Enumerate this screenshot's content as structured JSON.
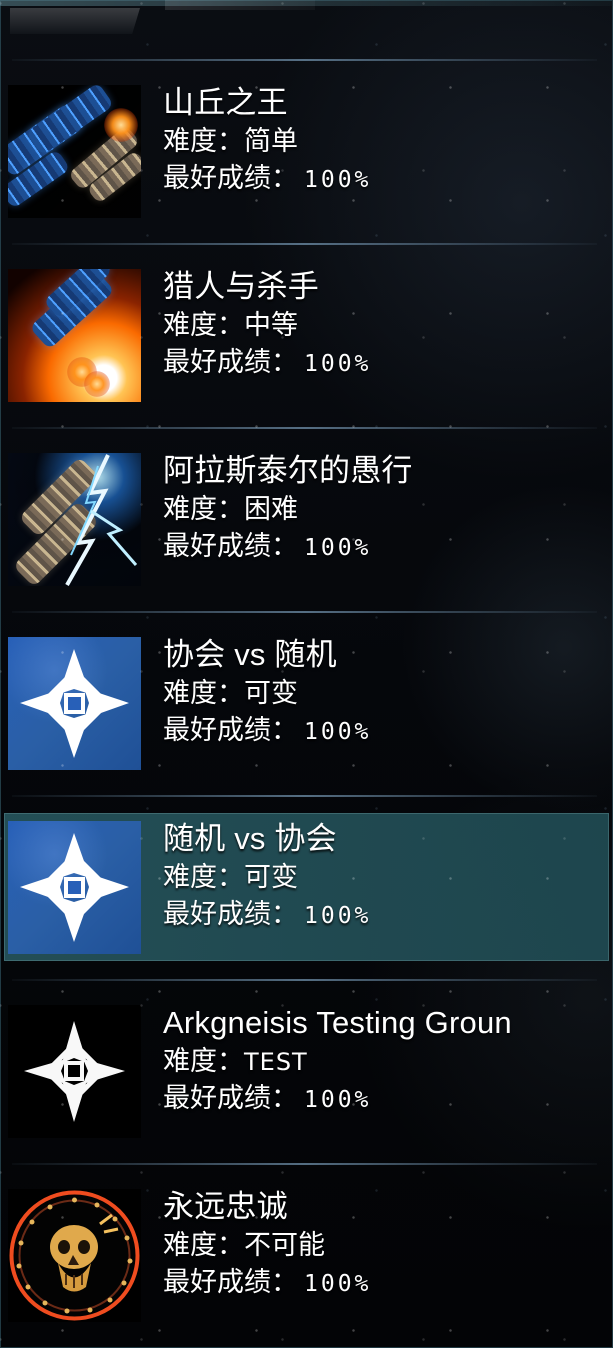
{
  "missions": [
    {
      "title": "山丘之王",
      "difficulty_label": "难度：",
      "difficulty_value": "简单",
      "score_label": "最好成绩：",
      "score_value": "100%",
      "icon": "battleship-fleet-icon"
    },
    {
      "title": "猎人与杀手",
      "difficulty_label": "难度：",
      "difficulty_value": "中等",
      "score_label": "最好成绩：",
      "score_value": "100%",
      "icon": "burning-warship-icon"
    },
    {
      "title": "阿拉斯泰尔的愚行",
      "difficulty_label": "难度：",
      "difficulty_value": "困难",
      "score_label": "最好成绩：",
      "score_value": "100%",
      "icon": "lightning-fleet-icon"
    },
    {
      "title": "协会 vs 随机",
      "difficulty_label": "难度：",
      "difficulty_value": "可变",
      "score_label": "最好成绩：",
      "score_value": "100%",
      "icon": "guild-emblem-icon"
    },
    {
      "title": "随机 vs 协会",
      "difficulty_label": "难度：",
      "difficulty_value": "可变",
      "score_label": "最好成绩：",
      "score_value": "100%",
      "icon": "guild-emblem-icon",
      "selected": true
    },
    {
      "title": "Arkgneisis Testing Groun",
      "difficulty_label": "难度：",
      "difficulty_value": "TEST",
      "score_label": "最好成绩：",
      "score_value": "100%",
      "icon": "white-star-emblem-icon"
    },
    {
      "title": "永远忠诚",
      "difficulty_label": "难度：",
      "difficulty_value": "不可能",
      "score_label": "最好成绩：",
      "score_value": "100%",
      "icon": "skull-medal-icon"
    }
  ],
  "colors": {
    "selected_row": "#2B5F67",
    "divider": "#7695B2",
    "text": "#FFFFFF"
  }
}
